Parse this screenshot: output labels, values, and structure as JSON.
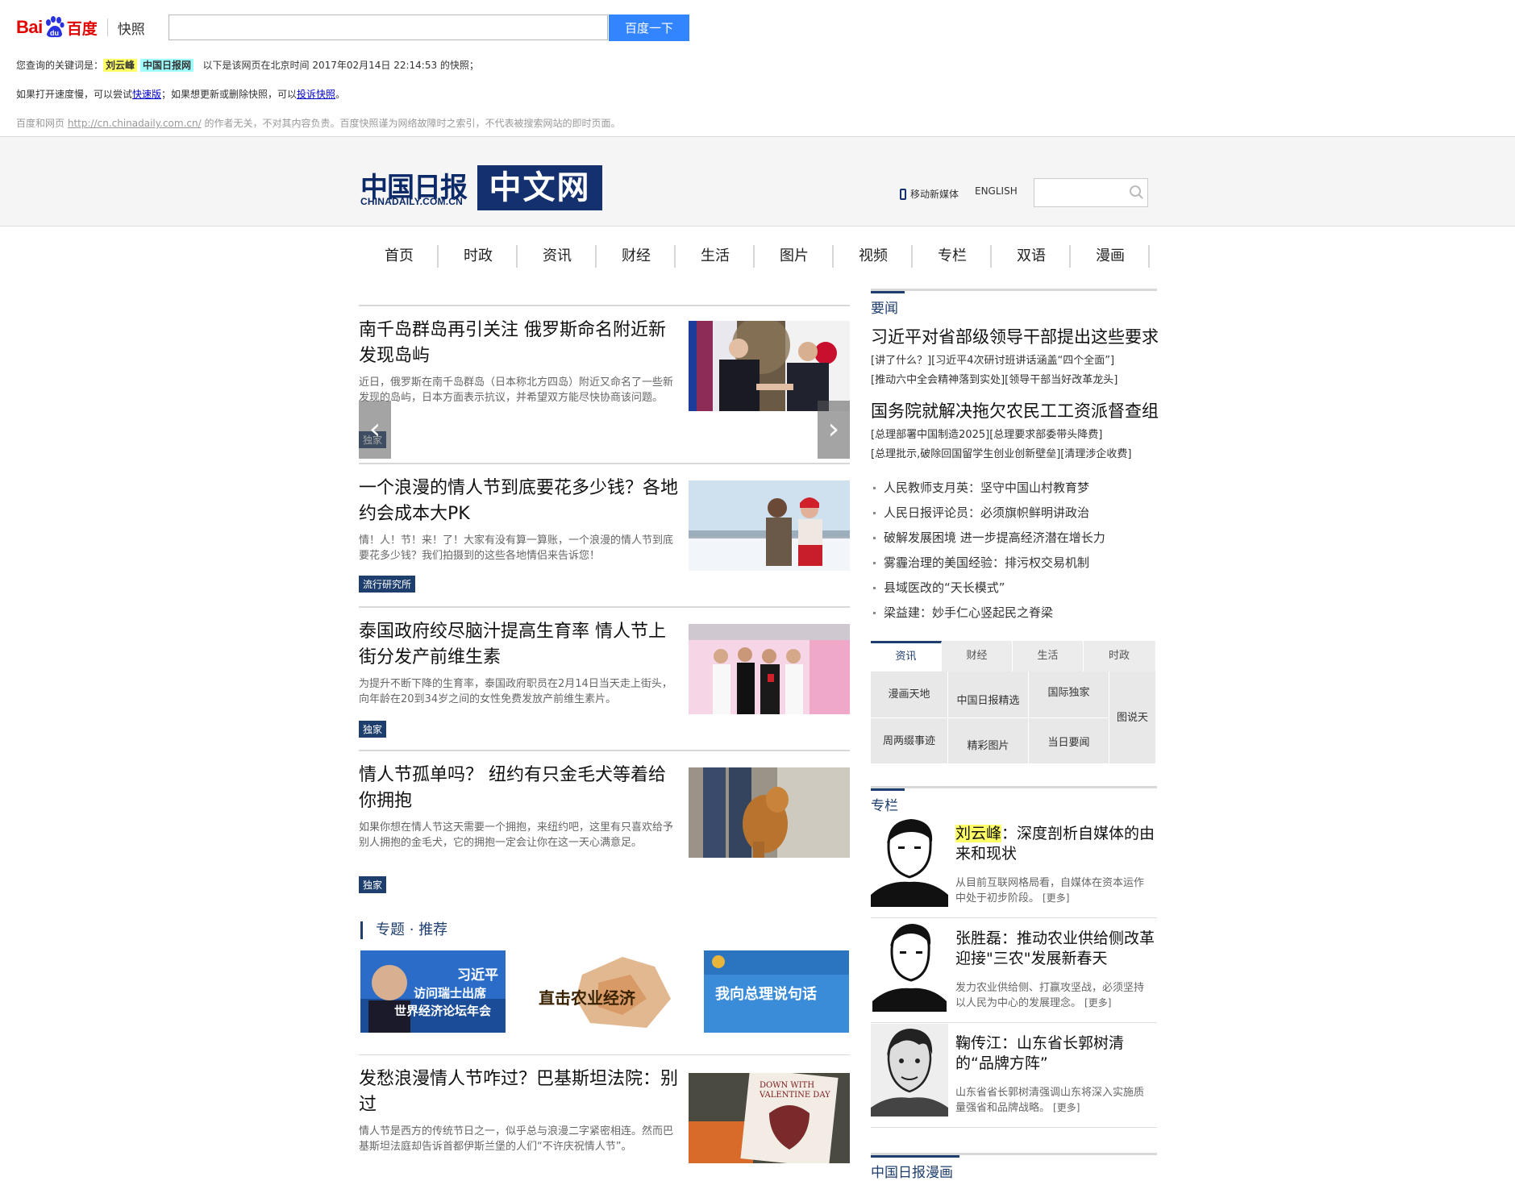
{
  "baidu": {
    "logo_bai": "Bai",
    "logo_du_cn": "百度",
    "snapshot_label": "快照",
    "search_value": "",
    "search_button": "百度一下",
    "line1_prefix": "您查询的关键词是：",
    "keyword1": "刘云峰",
    "keyword2": "中国日报网",
    "line1_suffix": "以下是该网页在北京时间 2017年02月14日 22:14:53 的快照；",
    "line2_a": "如果打开速度慢，可以尝试",
    "line2_link1": "快速版",
    "line2_b": "；如果想更新或删除快照，可以",
    "line2_link2": "投诉快照",
    "line2_c": "。",
    "line3_a": "百度和网页",
    "line3_url": "http://cn.chinadaily.com.cn/",
    "line3_b": "的作者无关，不对其内容负责。百度快照谨为网络故障时之索引，不代表被搜索网站的即时页面。"
  },
  "site": {
    "logo_cn": "中国日报",
    "logo_en": "CHINADAILY.COM.CN",
    "logo_box": "中文网",
    "mobile_label": "移动新媒体",
    "english_label": "ENGLISH",
    "search_value": ""
  },
  "nav": [
    "首页",
    "时政",
    "资讯",
    "财经",
    "生活",
    "图片",
    "视频",
    "专栏",
    "双语",
    "漫画"
  ],
  "news": [
    {
      "title": "南千岛群岛再引关注 俄罗斯命名附近新发现岛屿",
      "desc": "近日，俄罗斯在南千岛群岛（日本称北方四岛）附近又命名了一些新发现的岛屿，日本方面表示抗议，并希望双方能尽快协商该问题。",
      "tag": "独家"
    },
    {
      "title": "一个浪漫的情人节到底要花多少钱？各地约会成本大PK",
      "desc": "情！人！节！来！了！大家有没有算一算账，一个浪漫的情人节到底要花多少钱？我们拍摄到的这些各地情侣来告诉您！",
      "tag": "流行研究所"
    },
    {
      "title": "泰国政府绞尽脑汁提高生育率 情人节上街分发产前维生素",
      "desc": "为提升不断下降的生育率，泰国政府职员在2月14日当天走上街头，向年龄在20到34岁之间的女性免费发放产前维生素片。",
      "tag": "独家"
    },
    {
      "title": "情人节孤单吗？ 纽约有只金毛犬等着给你拥抱",
      "desc": "如果你想在情人节这天需要一个拥抱，来纽约吧，这里有只喜欢给予别人拥抱的金毛犬，它的拥抱一定会让你在这一天心满意足。",
      "tag": "独家"
    },
    {
      "title": "发愁浪漫情人节咋过？巴基斯坦法院：别过",
      "desc": "情人节是西方的传统节日之一，似乎总与浪漫二字紧密相连。然而巴基斯坦法庭却告诉首都伊斯兰堡的人们“不许庆祝情人节”。",
      "tag": ""
    }
  ],
  "topics": {
    "heading": "专题 · 推荐",
    "items": [
      {
        "line1": "习近平",
        "line2": "访问瑞士出席",
        "line3": "世界经济论坛年会"
      },
      {
        "line1": "直击农业经济"
      },
      {
        "line1": "我向总理说句话"
      }
    ]
  },
  "right": {
    "yaowen_label": "要闻",
    "headline1": "习近平对省部级领导干部提出这些要求",
    "headline1_sub": "[讲了什么？][习近平4次研讨班讲话涵盖“四个全面”]",
    "headline1_sub2": "[推动六中全会精神落到实处][领导干部当好改革龙头]",
    "headline2": "国务院就解决拖欠农民工工资派督查组",
    "headline2_sub": "[总理部署中国制造2025][总理要求部委带头降费]",
    "headline2_sub2": "[总理批示,破除回国留学生创业创新壁垒][清理涉企收费]",
    "list": [
      "人民教师支月英：坚守中国山村教育梦",
      "人民日报评论员：必须旗帜鲜明讲政治",
      "破解发展困境 进一步提高经济潜在增长力",
      "雾霾治理的美国经验：排污权交易机制",
      "县域医改的“天长模式”",
      "梁益建：妙手仁心竖起民之脊梁"
    ],
    "tabs": [
      "资讯",
      "财经",
      "生活",
      "时政"
    ],
    "grid": {
      "c1": "漫画天地",
      "c2": "中国日报精选",
      "c3": "国际独家",
      "c4": "图说天",
      "c5": "周两缀事迹",
      "c6": "精彩图片",
      "c7": "当日要闻"
    },
    "zhuanlan_label": "专栏",
    "columnists": [
      {
        "name": "刘云峰",
        "title_rest": "：深度剖析自媒体的由来和现状",
        "desc": "从目前互联网格局看，自媒体在资本运作中处于初步阶段。",
        "more": "[更多]"
      },
      {
        "name": "张胜磊",
        "title_rest": "：推动农业供给侧改革 迎接\"三农\"发展新春天",
        "desc": "发力农业供给侧、打赢攻坚战，必须坚持以人民为中心的发展理念。",
        "more": "[更多]"
      },
      {
        "name": "鞠传江",
        "title_rest": "：山东省长郭树清的“品牌方阵”",
        "desc": "山东省省长郭树清强调山东将深入实施质量强省和品牌战略。",
        "more": "[更多]"
      }
    ],
    "manhua_label": "中国日报漫画"
  },
  "colors": {
    "brand_navy": "#1e3e6e",
    "baidu_red": "#e10602",
    "baidu_blue": "#3385ff",
    "highlight_yellow": "#ffff66",
    "highlight_cyan": "#a0ffff"
  }
}
